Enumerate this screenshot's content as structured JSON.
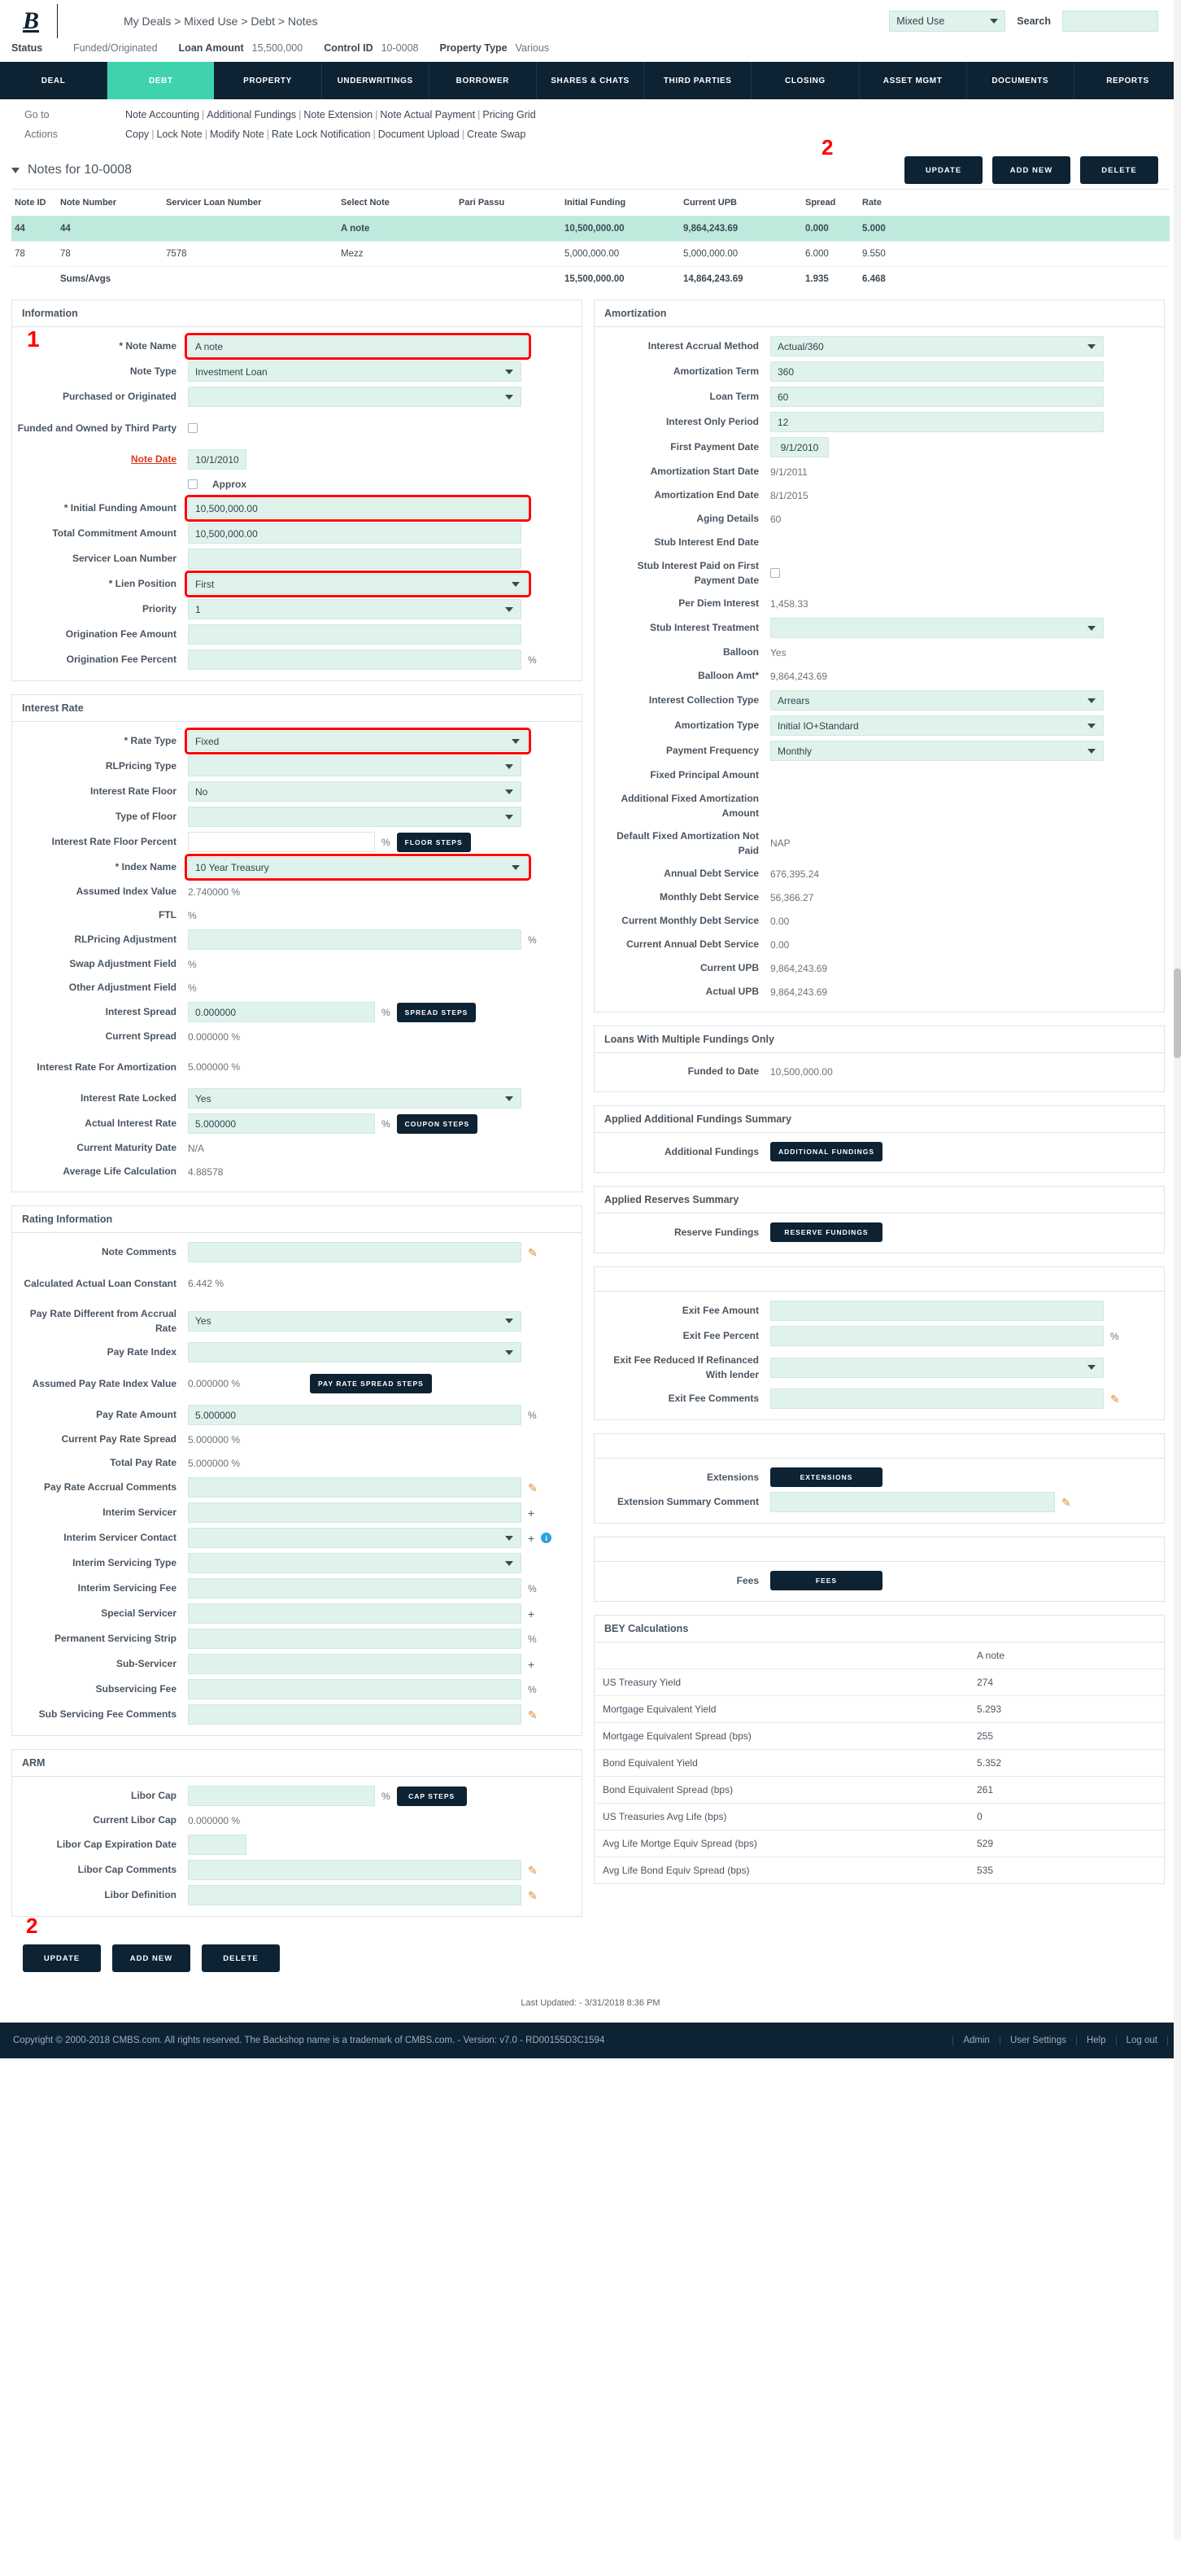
{
  "header": {
    "logo_text": "B",
    "breadcrumb": "My Deals > Mixed Use > Debt > Notes",
    "deal_select_value": "Mixed Use",
    "search_label": "Search",
    "search_value": ""
  },
  "status_bar": [
    {
      "label": "Status",
      "value": "Funded/Originated"
    },
    {
      "label": "Loan Amount",
      "value": "15,500,000"
    },
    {
      "label": "Control ID",
      "value": "10-0008"
    },
    {
      "label": "Property Type",
      "value": "Various"
    }
  ],
  "nav_tabs": [
    {
      "label": "DEAL",
      "active": false
    },
    {
      "label": "DEBT",
      "active": true
    },
    {
      "label": "PROPERTY",
      "active": false
    },
    {
      "label": "UNDERWRITINGS",
      "active": false
    },
    {
      "label": "BORROWER",
      "active": false
    },
    {
      "label": "SHARES & CHATS",
      "active": false
    },
    {
      "label": "THIRD PARTIES",
      "active": false
    },
    {
      "label": "CLOSING",
      "active": false
    },
    {
      "label": "ASSET MGMT",
      "active": false
    },
    {
      "label": "DOCUMENTS",
      "active": false
    },
    {
      "label": "REPORTS",
      "active": false
    }
  ],
  "goto": {
    "label": "Go to",
    "links": [
      "Note Accounting",
      "Additional Fundings",
      "Note Extension",
      "Note Actual Payment",
      "Pricing Grid"
    ]
  },
  "actions": {
    "label": "Actions",
    "links": [
      "Copy",
      "Lock Note",
      "Modify Note",
      "Rate Lock Notification",
      "Document Upload",
      "Create Swap"
    ]
  },
  "notes_panel": {
    "title": "Notes for 10-0008",
    "buttons": {
      "update": "UPDATE",
      "add_new": "ADD NEW",
      "delete": "DELETE"
    },
    "annotation_2": "2",
    "columns": [
      "Note ID",
      "Note Number",
      "Servicer Loan Number",
      "Select Note",
      "Pari Passu",
      "Initial Funding",
      "Current UPB",
      "Spread",
      "Rate"
    ],
    "rows": [
      {
        "note_id": "44",
        "note_number": "44",
        "servicer_loan_number": "",
        "select_note": "A note",
        "pari_passu": "",
        "initial_funding": "10,500,000.00",
        "current_upb": "9,864,243.69",
        "spread": "0.000",
        "rate": "5.000",
        "selected": true
      },
      {
        "note_id": "78",
        "note_number": "78",
        "servicer_loan_number": "7578",
        "select_note": "Mezz",
        "pari_passu": "",
        "initial_funding": "5,000,000.00",
        "current_upb": "5,000,000.00",
        "spread": "6.000",
        "rate": "9.550",
        "selected": false
      }
    ],
    "sums_row": {
      "note_id": "",
      "note_number": "Sums/Avgs",
      "servicer_loan_number": "",
      "select_note": "",
      "pari_passu": "",
      "initial_funding": "15,500,000.00",
      "current_upb": "14,864,243.69",
      "spread": "1.935",
      "rate": "6.468"
    }
  },
  "information": {
    "title": "Information",
    "annotation_1": "1",
    "note_name_label": "* Note Name",
    "note_name_value": "A note",
    "note_type_label": "Note Type",
    "note_type_value": "Investment Loan",
    "purchased_or_originated_label": "Purchased or Originated",
    "purchased_or_originated_value": "",
    "funded_owned_third_party_label": "Funded and Owned by Third Party",
    "note_date_label": "Note Date",
    "note_date_value": "10/1/2010",
    "approx_label": "Approx",
    "initial_funding_amount_label": "* Initial Funding Amount",
    "initial_funding_amount_value": "10,500,000.00",
    "total_commitment_amount_label": "Total Commitment Amount",
    "total_commitment_amount_value": "10,500,000.00",
    "servicer_loan_number_label": "Servicer Loan Number",
    "servicer_loan_number_value": "",
    "lien_position_label": "* Lien Position",
    "lien_position_value": "First",
    "priority_label": "Priority",
    "priority_value": "1",
    "origination_fee_amount_label": "Origination Fee Amount",
    "origination_fee_amount_value": "",
    "origination_fee_percent_label": "Origination Fee Percent",
    "origination_fee_percent_value": "",
    "pct": "%"
  },
  "interest_rate": {
    "title": "Interest Rate",
    "rate_type_label": "* Rate Type",
    "rate_type_value": "Fixed",
    "rlpricing_type_label": "RLPricing Type",
    "rlpricing_type_value": "",
    "interest_rate_floor_label": "Interest Rate Floor",
    "interest_rate_floor_value": "No",
    "type_of_floor_label": "Type of Floor",
    "type_of_floor_value": "",
    "interest_rate_floor_percent_label": "Interest Rate Floor Percent",
    "interest_rate_floor_percent_value": "",
    "floor_steps_button": "FLOOR STEPS",
    "index_name_label": "* Index Name",
    "index_name_value": "10 Year Treasury",
    "assumed_index_value_label": "Assumed Index Value",
    "assumed_index_value": "2.740000 %",
    "ftl_label": "FTL",
    "ftl_value": "%",
    "rlpricing_adjustment_label": "RLPricing Adjustment",
    "rlpricing_adjustment_value": "",
    "swap_adjustment_label": "Swap Adjustment Field",
    "swap_adjustment_value": "%",
    "other_adjustment_label": "Other Adjustment Field",
    "other_adjustment_value": "%",
    "interest_spread_label": "Interest Spread",
    "interest_spread_value": "0.000000",
    "spread_steps_button": "SPREAD STEPS",
    "current_spread_label": "Current Spread",
    "current_spread_value": "0.000000 %",
    "interest_rate_for_amortization_label": "Interest Rate For Amortization",
    "interest_rate_for_amortization_value": "5.000000 %",
    "interest_rate_locked_label": "Interest Rate Locked",
    "interest_rate_locked_value": "Yes",
    "actual_interest_rate_label": "Actual Interest Rate",
    "actual_interest_rate_value": "5.000000",
    "coupon_steps_button": "COUPON STEPS",
    "current_maturity_date_label": "Current Maturity Date",
    "current_maturity_date_value": "N/A",
    "average_life_calculation_label": "Average Life Calculation",
    "average_life_calculation_value": "4.88578",
    "pct": "%"
  },
  "rating_information": {
    "title": "Rating Information",
    "note_comments_label": "Note Comments",
    "note_comments_value": "",
    "calculated_actual_loan_constant_label": "Calculated Actual Loan Constant",
    "calculated_actual_loan_constant_value": "6.442 %",
    "pay_rate_different_label": "Pay Rate Different from Accrual Rate",
    "pay_rate_different_value": "Yes",
    "pay_rate_index_label": "Pay Rate Index",
    "pay_rate_index_value": "",
    "assumed_pay_rate_index_value_label": "Assumed Pay Rate Index Value",
    "assumed_pay_rate_index_value": "0.000000 %",
    "pay_rate_spread_steps_button": "PAY RATE SPREAD STEPS",
    "pay_rate_amount_label": "Pay Rate Amount",
    "pay_rate_amount_value": "5.000000",
    "current_pay_rate_spread_label": "Current Pay Rate Spread",
    "current_pay_rate_spread_value": "5.000000 %",
    "total_pay_rate_label": "Total Pay Rate",
    "total_pay_rate_value": "5.000000 %",
    "pay_rate_accrual_comments_label": "Pay Rate Accrual Comments",
    "pay_rate_accrual_comments_value": "",
    "interim_servicer_label": "Interim Servicer",
    "interim_servicer_value": "",
    "interim_servicer_contact_label": "Interim Servicer Contact",
    "interim_servicer_contact_value": "",
    "interim_servicing_type_label": "Interim Servicing Type",
    "interim_servicing_type_value": "",
    "interim_servicing_fee_label": "Interim Servicing Fee",
    "interim_servicing_fee_value": "",
    "special_servicer_label": "Special Servicer",
    "special_servicer_value": "",
    "permanent_servicing_strip_label": "Permanent Servicing Strip",
    "permanent_servicing_strip_value": "",
    "sub_servicer_label": "Sub-Servicer",
    "sub_servicer_value": "",
    "subservicing_fee_label": "Subservicing Fee",
    "subservicing_fee_value": "",
    "sub_servicing_fee_comments_label": "Sub Servicing Fee Comments",
    "sub_servicing_fee_comments_value": "",
    "pct": "%",
    "plus": "+"
  },
  "arm": {
    "title": "ARM",
    "libor_cap_label": "Libor Cap",
    "libor_cap_value": "",
    "cap_steps_button": "CAP STEPS",
    "current_libor_cap_label": "Current Libor Cap",
    "current_libor_cap_value": "0.000000 %",
    "libor_cap_expiration_date_label": "Libor Cap Expiration Date",
    "libor_cap_expiration_date_value": "",
    "libor_cap_comments_label": "Libor Cap Comments",
    "libor_cap_comments_value": "",
    "libor_definition_label": "Libor Definition",
    "libor_definition_value": "",
    "pct": "%"
  },
  "amortization": {
    "title": "Amortization",
    "interest_accrual_method_label": "Interest Accrual Method",
    "interest_accrual_method_value": "Actual/360",
    "amortization_term_label": "Amortization Term",
    "amortization_term_value": "360",
    "loan_term_label": "Loan Term",
    "loan_term_value": "60",
    "interest_only_period_label": "Interest Only Period",
    "interest_only_period_value": "12",
    "first_payment_date_label": "First Payment Date",
    "first_payment_date_value": "9/1/2010",
    "amortization_start_date_label": "Amortization Start Date",
    "amortization_start_date_value": "9/1/2011",
    "amortization_end_date_label": "Amortization End Date",
    "amortization_end_date_value": "8/1/2015",
    "aging_details_label": "Aging Details",
    "aging_details_value": "60",
    "stub_interest_end_date_label": "Stub Interest End Date",
    "stub_interest_end_date_value": "",
    "stub_interest_paid_first_label": "Stub Interest Paid on First Payment Date",
    "per_diem_interest_label": "Per Diem Interest",
    "per_diem_interest_value": "1,458.33",
    "stub_interest_treatment_label": "Stub Interest Treatment",
    "stub_interest_treatment_value": "",
    "balloon_label": "Balloon",
    "balloon_value": "Yes",
    "balloon_amt_label": "Balloon Amt*",
    "balloon_amt_value": "9,864,243.69",
    "interest_collection_type_label": "Interest Collection Type",
    "interest_collection_type_value": "Arrears",
    "amortization_type_label": "Amortization Type",
    "amortization_type_value": "Initial IO+Standard",
    "payment_frequency_label": "Payment Frequency",
    "payment_frequency_value": "Monthly",
    "fixed_principal_amount_label": "Fixed Principal Amount",
    "fixed_principal_amount_value": "",
    "additional_fixed_amortization_amount_label": "Additional Fixed Amortization Amount",
    "additional_fixed_amortization_amount_value": "",
    "default_fixed_amortization_not_paid_label": "Default Fixed Amortization Not Paid",
    "default_fixed_amortization_not_paid_value": "NAP",
    "annual_debt_service_label": "Annual Debt Service",
    "annual_debt_service_value": "676,395.24",
    "monthly_debt_service_label": "Monthly Debt Service",
    "monthly_debt_service_value": "56,366.27",
    "current_monthly_debt_service_label": "Current Monthly Debt Service",
    "current_monthly_debt_service_value": "0.00",
    "current_annual_debt_service_label": "Current Annual Debt Service",
    "current_annual_debt_service_value": "0.00",
    "current_upb_label": "Current UPB",
    "current_upb_value": "9,864,243.69",
    "actual_upb_label": "Actual UPB",
    "actual_upb_value": "9,864,243.69"
  },
  "loans_multiple_fundings": {
    "title": "Loans With Multiple Fundings Only",
    "funded_to_date_label": "Funded to Date",
    "funded_to_date_value": "10,500,000.00"
  },
  "applied_additional_fundings": {
    "title": "Applied Additional Fundings Summary",
    "additional_fundings_label": "Additional Fundings",
    "additional_fundings_button": "ADDITIONAL FUNDINGS"
  },
  "applied_reserves": {
    "title": "Applied Reserves Summary",
    "reserve_fundings_label": "Reserve Fundings",
    "reserve_fundings_button": "RESERVE FUNDINGS"
  },
  "exit_fee": {
    "title": "",
    "exit_fee_amount_label": "Exit Fee Amount",
    "exit_fee_amount_value": "",
    "exit_fee_percent_label": "Exit Fee Percent",
    "exit_fee_percent_value": "",
    "exit_fee_reduced_label": "Exit Fee Reduced If Refinanced With lender",
    "exit_fee_reduced_value": "",
    "exit_fee_comments_label": "Exit Fee Comments",
    "exit_fee_comments_value": "",
    "pct": "%"
  },
  "extensions_panel": {
    "title": "",
    "extensions_label": "Extensions",
    "extensions_button": "EXTENSIONS",
    "extension_summary_comment_label": "Extension Summary Comment",
    "extension_summary_comment_value": ""
  },
  "fees_panel": {
    "title": "",
    "fees_label": "Fees",
    "fees_button": "FEES"
  },
  "bey": {
    "title": "BEY Calculations",
    "value_column_header": "A note",
    "rows": [
      {
        "label": "US Treasury Yield",
        "value": "274"
      },
      {
        "label": "Mortgage Equivalent Yield",
        "value": "5.293"
      },
      {
        "label": "Mortgage Equivalent Spread (bps)",
        "value": "255"
      },
      {
        "label": "Bond Equivalent Yield",
        "value": "5.352"
      },
      {
        "label": "Bond Equivalent Spread (bps)",
        "value": "261"
      },
      {
        "label": "US Treasuries Avg Life (bps)",
        "value": "0"
      },
      {
        "label": "Avg Life Mortge Equiv Spread (bps)",
        "value": "529"
      },
      {
        "label": "Avg Life Bond Equiv Spread (bps)",
        "value": "535"
      }
    ]
  },
  "bottom": {
    "annotation_2": "2",
    "update": "UPDATE",
    "add_new": "ADD NEW",
    "delete": "DELETE",
    "last_updated": "Last Updated: - 3/31/2018 8:36 PM"
  },
  "footer": {
    "copyright": "Copyright © 2000-2018 CMBS.com. All rights reserved. The Backshop name is a trademark of CMBS.com. - Version: v7.0 - RD00155D3C1594",
    "links": [
      "Admin",
      "User Settings",
      "Help",
      "Log out"
    ]
  }
}
